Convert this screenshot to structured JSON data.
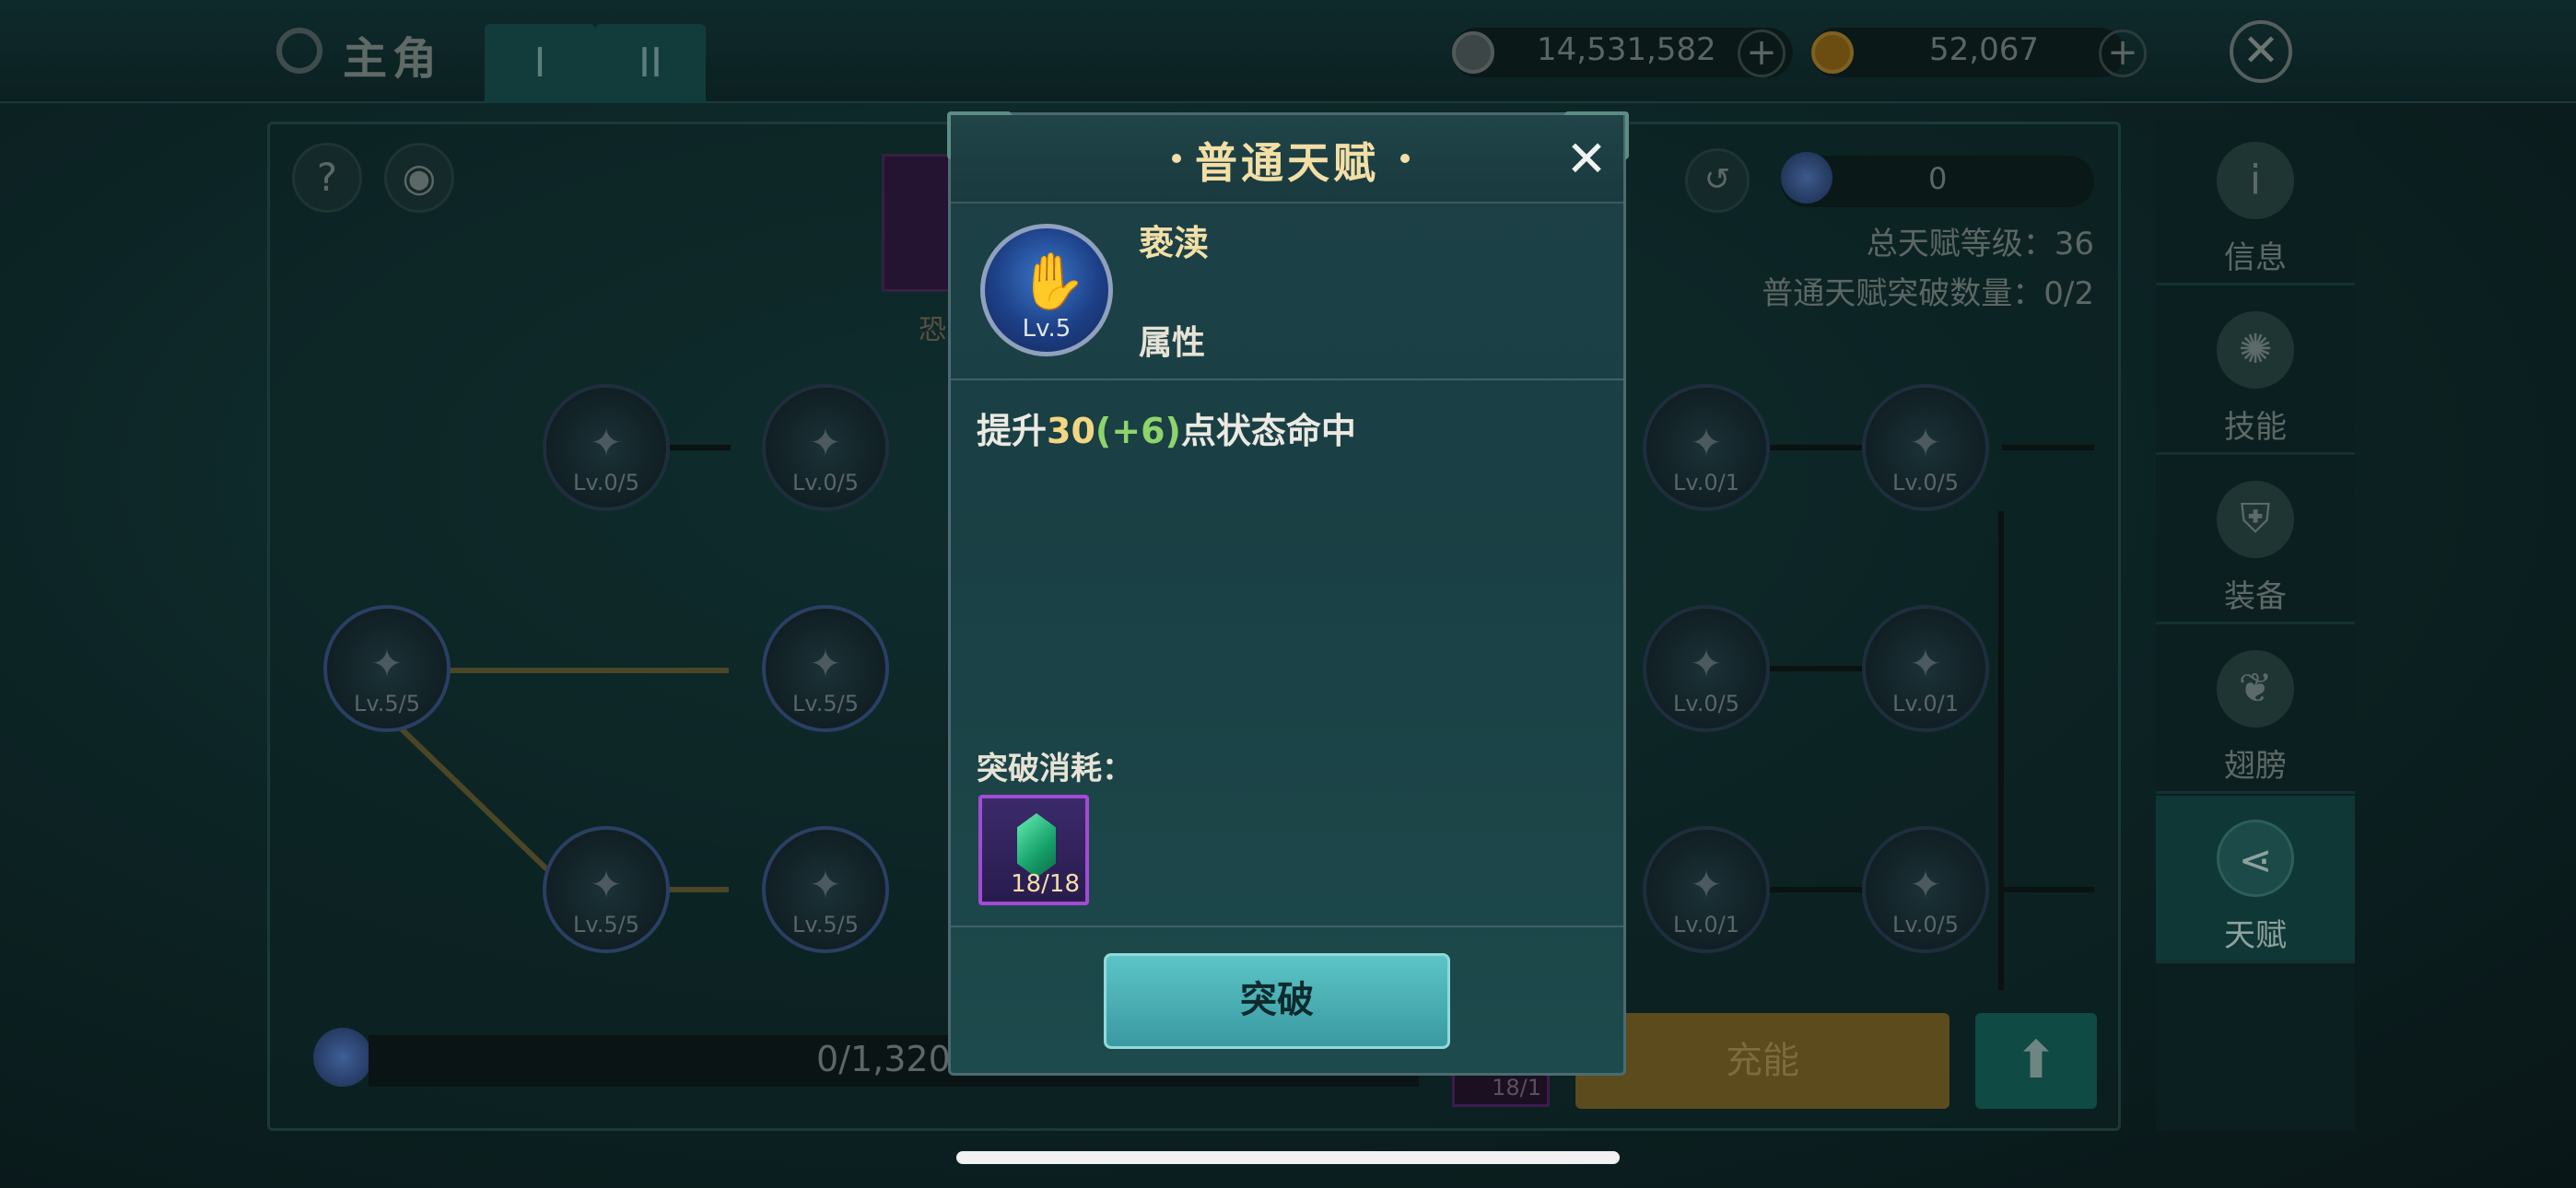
{
  "topbar": {
    "title": "主角",
    "tabs": [
      "I",
      "II"
    ],
    "silver_amount": "14,531,582",
    "gold_amount": "52,067",
    "plus": "+",
    "close": "✕"
  },
  "sidebar": {
    "items": [
      {
        "label": "信息",
        "icon": "info-icon"
      },
      {
        "label": "技能",
        "icon": "skill-icon"
      },
      {
        "label": "装备",
        "icon": "equipment-icon"
      },
      {
        "label": "翅膀",
        "icon": "wings-icon"
      },
      {
        "label": "天赋",
        "icon": "talent-share-icon"
      }
    ],
    "active_index": 4
  },
  "panel": {
    "help": "?",
    "gem_value": "0",
    "total_level": "总天赋等级：36",
    "break_count": "普通天赋突破数量：0/2",
    "progress_text": "0/1,320",
    "charge_label": "充能",
    "up_arrow": "⬆",
    "mini_item_count": "18/1",
    "bg_talent_label": "恐",
    "nodes": [
      {
        "lv": "Lv.0/5"
      },
      {
        "lv": "Lv.0/5"
      },
      {
        "lv": "Lv.0/1"
      },
      {
        "lv": "Lv.0/5"
      },
      {
        "lv": "Lv.5/5"
      },
      {
        "lv": "Lv.5/5"
      },
      {
        "lv": "Lv.0/5"
      },
      {
        "lv": "Lv.0/1"
      },
      {
        "lv": "Lv.5/5"
      },
      {
        "lv": "Lv.5/5"
      },
      {
        "lv": "Lv.0/1"
      },
      {
        "lv": "Lv.0/5"
      }
    ]
  },
  "modal": {
    "title": "普通天赋",
    "close": "✕",
    "talent_name": "亵渎",
    "talent_level": "Lv.5",
    "talent_type": "属性",
    "desc_prefix": "提升",
    "desc_value": "30",
    "desc_bonus": "(+6)",
    "desc_suffix": "点状态命中",
    "cost_label": "突破消耗：",
    "cost_count": "18/18",
    "break_button": "突破"
  },
  "colors": {
    "accent_gold": "#f3dfa6",
    "bonus_green": "#8fd46b",
    "button_teal": "#4fb6b9",
    "rare_purple": "#a34bd6"
  }
}
